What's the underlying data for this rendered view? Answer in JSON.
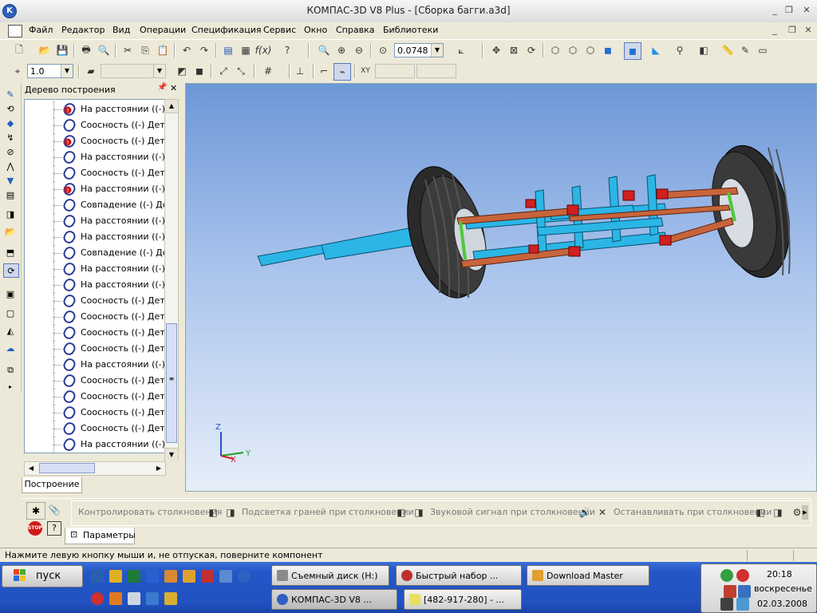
{
  "window": {
    "title": "КОМПАС-3D V8 Plus - [Сборка багги.a3d]"
  },
  "menu": {
    "items": [
      "Файл",
      "Редактор",
      "Вид",
      "Операции",
      "Спецификация",
      "Сервис",
      "Окно",
      "Справка",
      "Библиотеки"
    ]
  },
  "toolbar_view": {
    "zoom_value": "0.0748"
  },
  "toolbar_current": {
    "step_value": "1.0"
  },
  "tree": {
    "panel_title": "Дерево построения",
    "tab_label": "Построение",
    "rows": [
      {
        "label": "На расстоянии ((-) Д",
        "icon": "warning-constraint-icon"
      },
      {
        "label": "Соосность ((-) Детал",
        "icon": "constraint-icon"
      },
      {
        "label": "Соосность ((-) Детал",
        "icon": "warning-constraint-icon"
      },
      {
        "label": "На расстоянии ((-) Д",
        "icon": "constraint-icon"
      },
      {
        "label": "Соосность ((-) Детал",
        "icon": "constraint-icon"
      },
      {
        "label": "На расстоянии ((-) Д",
        "icon": "warning-constraint-icon"
      },
      {
        "label": "Совпадение ((-) Дет",
        "icon": "constraint-icon"
      },
      {
        "label": "На расстоянии ((-) Д",
        "icon": "constraint-icon"
      },
      {
        "label": "На расстоянии ((-) Д",
        "icon": "constraint-icon"
      },
      {
        "label": "Совпадение ((-) Дет",
        "icon": "constraint-icon"
      },
      {
        "label": "На расстоянии ((-) Д",
        "icon": "constraint-icon"
      },
      {
        "label": "На расстоянии ((-) Д",
        "icon": "constraint-icon"
      },
      {
        "label": "Соосность ((-) Детал",
        "icon": "constraint-icon"
      },
      {
        "label": "Соосность ((-) Детал",
        "icon": "constraint-icon"
      },
      {
        "label": "Соосность ((-) Детал",
        "icon": "constraint-icon"
      },
      {
        "label": "Соосность ((-) Детал",
        "icon": "constraint-icon"
      },
      {
        "label": "На расстоянии ((-) Д",
        "icon": "constraint-icon"
      },
      {
        "label": "Соосность ((-) Детал",
        "icon": "constraint-icon"
      },
      {
        "label": "Соосность ((-) Детал",
        "icon": "constraint-icon"
      },
      {
        "label": "Соосность ((-) Детал",
        "icon": "constraint-icon"
      },
      {
        "label": "Соосность ((-) Детал",
        "icon": "constraint-icon"
      },
      {
        "label": "На расстоянии ((-) Д",
        "icon": "constraint-icon"
      }
    ]
  },
  "viewport": {
    "axis_z": "Z",
    "axis_x": "X",
    "axis_y": "Y",
    "model_colors": {
      "frame": "#2bb6e6",
      "link": "#c8643c",
      "bracket": "#d02020",
      "tire": "#2a2a2a",
      "spring": "#4fc83c"
    }
  },
  "property_bar": {
    "tab_label": "Параметры",
    "options": [
      "Контролировать столкновения",
      "Подсветка граней при столкновении",
      "Звуковой сигнал при столкновении",
      "Останавливать при столкновении"
    ]
  },
  "status_bar": {
    "message": "Нажмите левую кнопку мыши и, не отпуская, поверните компонент"
  },
  "taskbar": {
    "start_label": "пуск",
    "tasks": [
      {
        "label": "Съемный диск (H:)"
      },
      {
        "label": "Быстрый набор ..."
      },
      {
        "label": "Download Master"
      },
      {
        "label": "КОМПАС-3D V8 ..."
      },
      {
        "label": "[482-917-280] - ..."
      }
    ],
    "clock": {
      "time": "20:18",
      "day": "воскресенье",
      "date": "02.03.2008"
    }
  }
}
